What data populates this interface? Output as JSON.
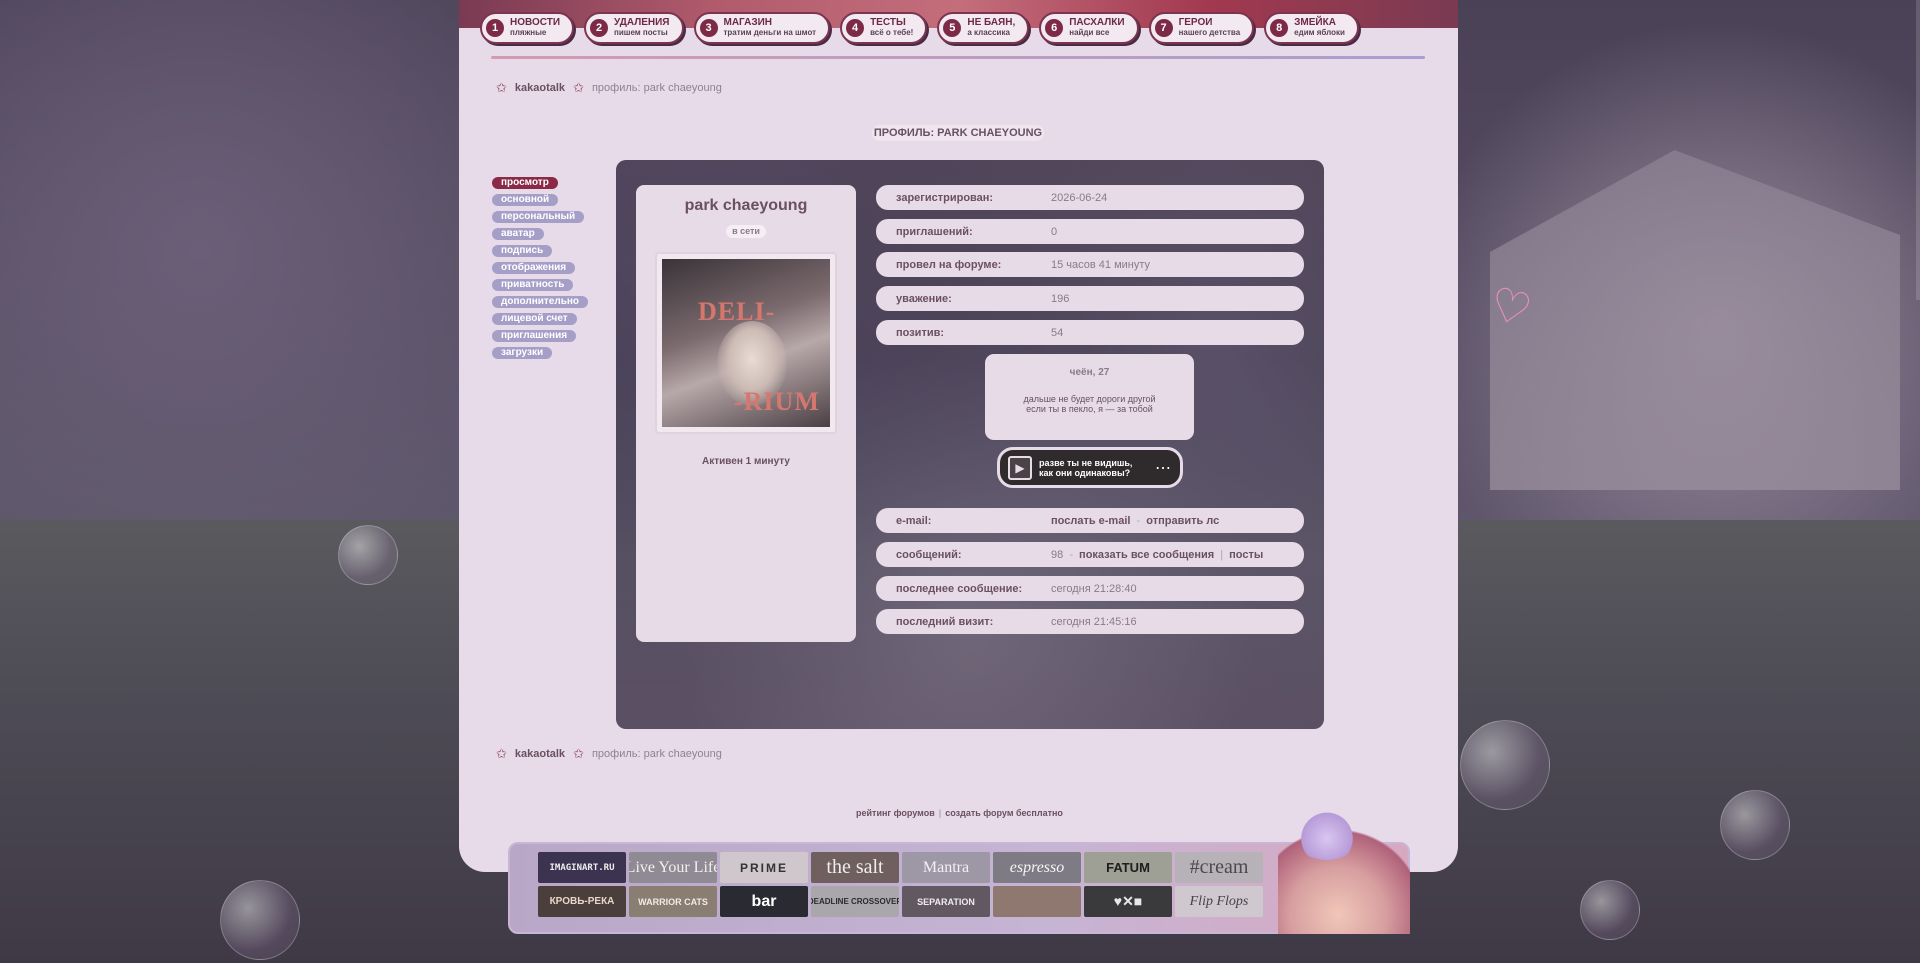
{
  "nav": [
    {
      "num": "1",
      "title": "НОВОСТИ",
      "sub": "пляжные"
    },
    {
      "num": "2",
      "title": "УДАЛЕНИЯ",
      "sub": "пишем посты"
    },
    {
      "num": "3",
      "title": "МАГАЗИН",
      "sub": "тратим деньги на шмот"
    },
    {
      "num": "4",
      "title": "ТЕСТЫ",
      "sub": "всё о тебе!"
    },
    {
      "num": "5",
      "title": "НЕ БАЯН,",
      "sub": "а классика"
    },
    {
      "num": "6",
      "title": "ПАСХАЛКИ",
      "sub": "найди все"
    },
    {
      "num": "7",
      "title": "ГЕРОИ",
      "sub": "нашего детства"
    },
    {
      "num": "8",
      "title": "ЗМЕЙКА",
      "sub": "едим яблоки"
    }
  ],
  "breadcrumb": {
    "home": "kakaotalk",
    "current": "профиль: park chaeyoung"
  },
  "page_title": "ПРОФИЛЬ: PARK CHAEYOUNG",
  "side_menu": [
    "просмотр",
    "основной",
    "персональный",
    "аватар",
    "подпись",
    "отображения",
    "приватность",
    "дополнительно",
    "лицевой счет",
    "приглашения",
    "загрузки"
  ],
  "user": {
    "name": "park chaeyoung",
    "status": "в сети",
    "avatar_text_top": "DELI-",
    "avatar_text_bottom": "-RIUM",
    "active": "Активен 1 минуту"
  },
  "fields_top": [
    {
      "label": "зарегистрирован:",
      "value": "2026-06-24"
    },
    {
      "label": "приглашений:",
      "value": "0"
    },
    {
      "label": "провел на форуме:",
      "value": "15 часов 41 минуту"
    },
    {
      "label": "уважение:",
      "value": "196"
    },
    {
      "label": "позитив:",
      "value": "54"
    }
  ],
  "quote": {
    "head": "чеён, 27",
    "line1": "дальше не будет дороги другой",
    "line2": "если ты в пекло, я — за тобой"
  },
  "player": {
    "line1": "разве ты не видишь,",
    "line2": "как они одинаковы?"
  },
  "email": {
    "label": "e-mail:",
    "send_email": "послать e-mail",
    "dash": "-",
    "send_pm": "отправить лс"
  },
  "posts": {
    "label": "сообщений:",
    "count": "98",
    "dash": "-",
    "show_all": "показать все сообщения",
    "divider": "|",
    "posts_link": "посты"
  },
  "last_post": {
    "label": "последнее сообщение:",
    "value": "сегодня 21:28:40"
  },
  "last_visit": {
    "label": "последний визит:",
    "value": "сегодня 21:45:16"
  },
  "footer": {
    "rating": "рейтинг форумов",
    "divider": "|",
    "create": "создать форум бесплатно"
  },
  "banners": [
    "IMAGINART.RU",
    "Live Your Life",
    "PRIME",
    "the salt",
    "Mantra",
    "espresso",
    "FATUM",
    "#cream",
    "КРОВЬ-РЕКА",
    "WARRIOR CATS",
    "bar",
    "DEADLINE CROSSOVER",
    "SEPARATION",
    "",
    "♥✕■",
    "Flip Flops"
  ],
  "colors": {
    "accent": "#8a2a46",
    "card": "#e7dbe9",
    "menu": "#a59fc8"
  }
}
